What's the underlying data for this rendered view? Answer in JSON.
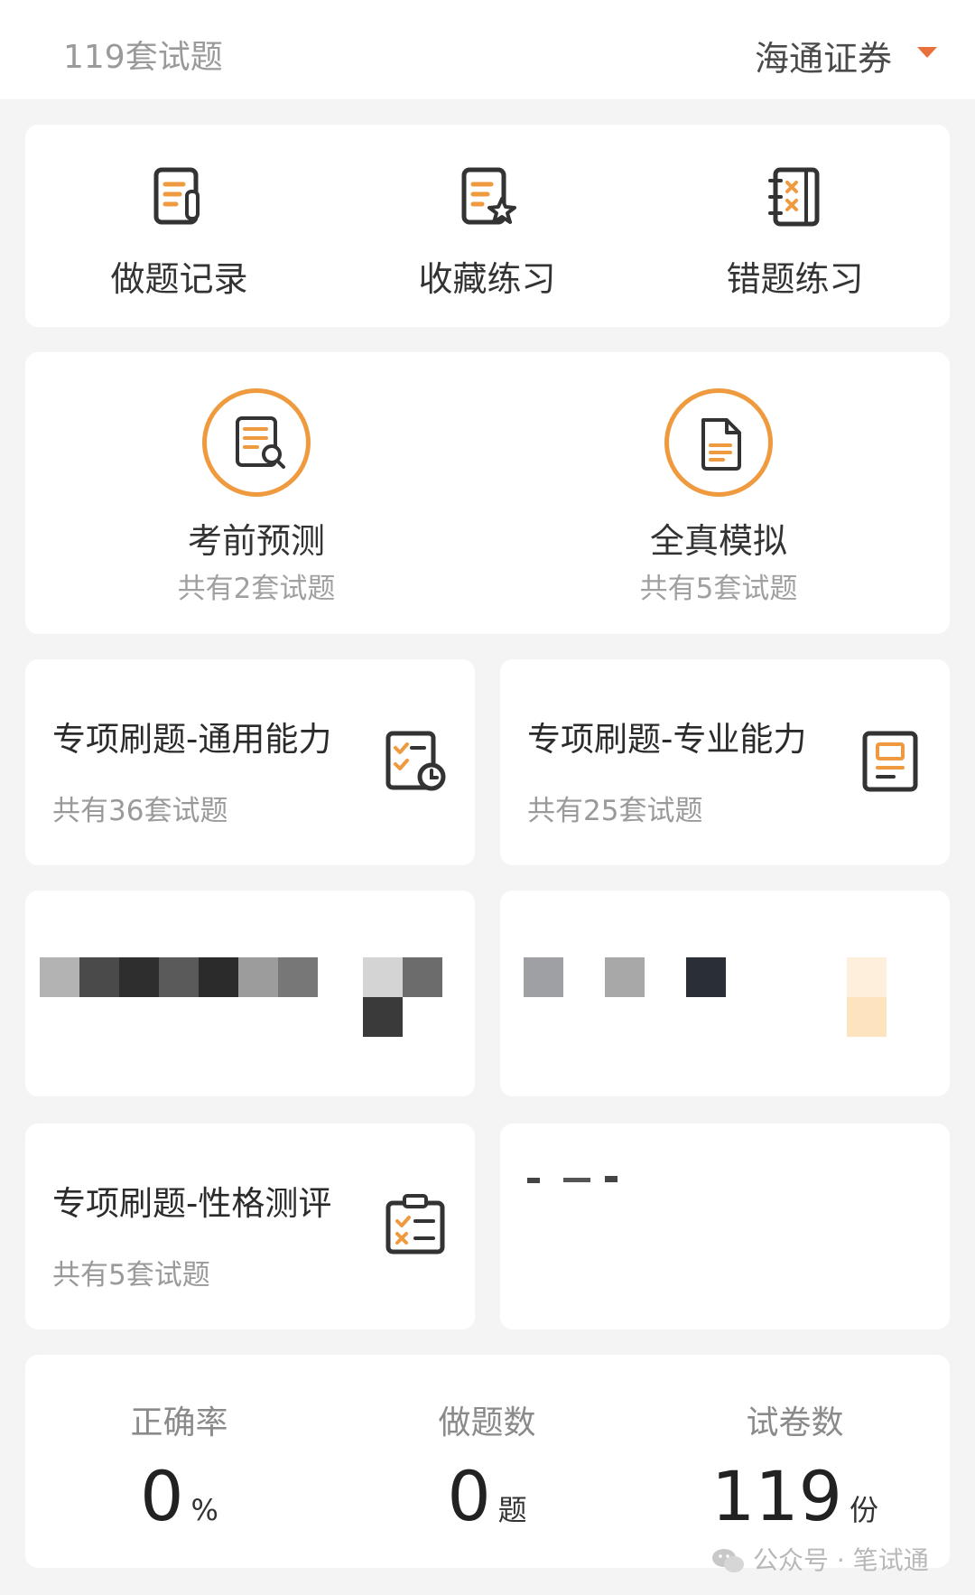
{
  "header": {
    "set_count": "119套试题",
    "company": "海通证券"
  },
  "quick_actions": [
    {
      "label": "做题记录",
      "icon": "document-pencil-icon"
    },
    {
      "label": "收藏练习",
      "icon": "document-star-icon"
    },
    {
      "label": "错题练习",
      "icon": "notebook-x-icon"
    }
  ],
  "predict": [
    {
      "title": "考前预测",
      "subtitle": "共有2套试题",
      "icon": "document-search-icon"
    },
    {
      "title": "全真模拟",
      "subtitle": "共有5套试题",
      "icon": "document-icon"
    }
  ],
  "practice": [
    {
      "title": "专项刷题-通用能力",
      "subtitle": "共有36套试题",
      "icon": "checklist-clock-icon"
    },
    {
      "title": "专项刷题-专业能力",
      "subtitle": "共有25套试题",
      "icon": "document-book-icon"
    },
    {
      "title": "专项刷题-性格测评",
      "subtitle": "共有5套试题",
      "icon": "clipboard-check-icon"
    }
  ],
  "stats": [
    {
      "label": "正确率",
      "value": "0",
      "unit": "%"
    },
    {
      "label": "做题数",
      "value": "0",
      "unit": "题"
    },
    {
      "label": "试卷数",
      "value": "119",
      "unit": "份"
    }
  ],
  "watermark": {
    "text": "公众号 · 笔试通"
  },
  "colors": {
    "accent": "#ef9a3e",
    "caret": "#e8703a",
    "icon_dark": "#333333"
  }
}
